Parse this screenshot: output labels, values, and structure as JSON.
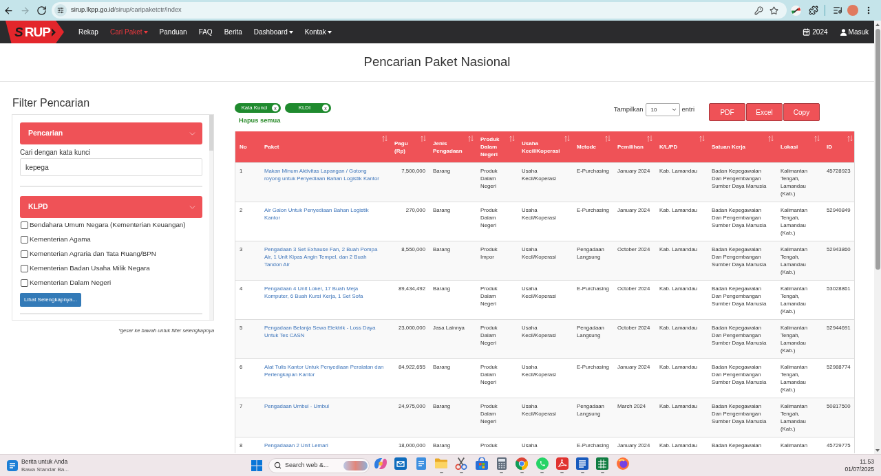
{
  "browser": {
    "nav_buttons": [
      {
        "kind": "back",
        "disabled": false
      },
      {
        "kind": "forward",
        "disabled": true
      },
      {
        "kind": "reload",
        "disabled": false
      }
    ],
    "url": {
      "host": "sirup.lkpp.go.id",
      "path": "/sirup/caripaketctr/index"
    }
  },
  "navbar": {
    "logo": {
      "dark_part": "S",
      "light_part": "RUP"
    },
    "items": [
      {
        "label": "Rekap",
        "selected": false,
        "dropdown": false
      },
      {
        "label": "Cari Paket",
        "selected": true,
        "dropdown": true
      },
      {
        "label": "Panduan",
        "selected": false,
        "dropdown": false
      },
      {
        "label": "FAQ",
        "selected": false,
        "dropdown": false
      },
      {
        "label": "Berita",
        "selected": false,
        "dropdown": false
      },
      {
        "label": "Dashboard",
        "selected": false,
        "dropdown": true
      },
      {
        "label": "Kontak",
        "selected": false,
        "dropdown": true
      }
    ],
    "right_items": [
      {
        "kind": "calendar",
        "label": "2024"
      },
      {
        "kind": "user",
        "label": "Masuk"
      }
    ]
  },
  "page_title": "Pencarian Paket Nasional",
  "filter": {
    "title": "Filter Pencarian",
    "sections": [
      {
        "kind": "search",
        "title": "Pencarian",
        "field_label": "Cari dengan kata kunci",
        "value": "kepega"
      },
      {
        "kind": "checklist",
        "title": "KLPD",
        "options": [
          {
            "label": "Bendahara Umum Negara (Kementerian Keuangan)",
            "checked": false
          },
          {
            "label": "Kementerian Agama",
            "checked": false
          },
          {
            "label": "Kementerian Agraria dan Tata Ruang/BPN",
            "checked": false
          },
          {
            "label": "Kementerian Badan Usaha Milik Negara",
            "checked": false
          },
          {
            "label": "Kementerian Dalam Negeri",
            "checked": false
          }
        ],
        "more_button": "Lihat Selengkapnya..."
      }
    ],
    "note": "*geser ke bawah untuk filter selengkapnya"
  },
  "active_filters": {
    "chips": [
      {
        "label": "Kata Kunci",
        "remove": "x"
      },
      {
        "label": "KLDI",
        "remove": "x"
      }
    ],
    "clear_all": "Hapus semua"
  },
  "page_length": {
    "label": "Tampilkan",
    "value": "10",
    "suffix": "entri"
  },
  "export_buttons": [
    "PDF",
    "Excel",
    "Copy"
  ],
  "table": {
    "columns": [
      {
        "label": "No",
        "kind": "text",
        "sortable": false
      },
      {
        "label": "Paket",
        "kind": "link",
        "sortable": true
      },
      {
        "label": "Pagu (Rp)",
        "kind": "number",
        "sortable": true
      },
      {
        "label": "Jenis Pengadaan",
        "kind": "text",
        "sortable": true
      },
      {
        "label": "Produk Dalam Negeri",
        "kind": "text",
        "sortable": true
      },
      {
        "label": "Usaha Kecil/Koperasi",
        "kind": "text",
        "sortable": true
      },
      {
        "label": "Metode",
        "kind": "text",
        "sortable": true
      },
      {
        "label": "Pemilihan",
        "kind": "text",
        "sortable": true
      },
      {
        "label": "K/L/PD",
        "kind": "text",
        "sortable": true
      },
      {
        "label": "Satuan Kerja",
        "kind": "text",
        "sortable": true
      },
      {
        "label": "Lokasi",
        "kind": "text",
        "sortable": true
      },
      {
        "label": "ID",
        "kind": "text",
        "sortable": true
      }
    ],
    "rows": [
      [
        "1",
        "Makan Minum Aktivitas Lapangan / Gotong royong untuk Penyediaan Bahan Logistik Kantor",
        "7,500,000",
        "Barang",
        "Produk Dalam Negeri",
        "Usaha Kecil/Koperasi",
        "E-Purchasing",
        "January 2024",
        "Kab. Lamandau",
        "Badan Kepegawaian Dan Pengembangan Sumber Daya Manusia",
        "Kalimantan Tengah, Lamandau (Kab.)",
        "45728923"
      ],
      [
        "2",
        "Air Galon Untuk Penyediaan Bahan Logistik Kantor",
        "270,000",
        "Barang",
        "Produk Dalam Negeri",
        "Usaha Kecil/Koperasi",
        "E-Purchasing",
        "January 2024",
        "Kab. Lamandau",
        "Badan Kepegawaian Dan Pengembangan Sumber Daya Manusia",
        "Kalimantan Tengah, Lamandau (Kab.)",
        "52940849"
      ],
      [
        "3",
        "Pengadaan 3 Set Exhause Fan, 2 Buah Pompa Air, 1 Unit Kipas Angin Tempel, dan 2 Buah Tandon Air",
        "8,550,000",
        "Barang",
        "Produk Impor",
        "Usaha Kecil/Koperasi",
        "Pengadaan Langsung",
        "October 2024",
        "Kab. Lamandau",
        "Badan Kepegawaian Dan Pengembangan Sumber Daya Manusia",
        "Kalimantan Tengah, Lamandau (Kab.)",
        "52943860"
      ],
      [
        "4",
        "Pengadaan 4 Unit Loker, 17 Buah Meja Komputer, 6 Buah Kursi Kerja, 1 Set Sofa",
        "89,434,492",
        "Barang",
        "Produk Dalam Negeri",
        "Usaha Kecil/Koperasi",
        "E-Purchasing",
        "October 2024",
        "Kab. Lamandau",
        "Badan Kepegawaian Dan Pengembangan Sumber Daya Manusia",
        "Kalimantan Tengah, Lamandau (Kab.)",
        "53028861"
      ],
      [
        "5",
        "Pengadaan Belanja Sewa Elektrik - Loss Daya Untuk Tes CASN",
        "23,000,000",
        "Jasa Lainnya",
        "Produk Dalam Negeri",
        "Usaha Kecil/Koperasi",
        "Pengadaan Langsung",
        "October 2024",
        "Kab. Lamandau",
        "Badan Kepegawaian Dan Pengembangan Sumber Daya Manusia",
        "Kalimantan Tengah, Lamandau (Kab.)",
        "52944691"
      ],
      [
        "6",
        "Alat Tulis Kantor Untuk Penyediaan Peralatan dan Perlengkapan Kantor",
        "84,922,655",
        "Barang",
        "Produk Dalam Negeri",
        "Usaha Kecil/Koperasi",
        "E-Purchasing",
        "January 2024",
        "Kab. Lamandau",
        "Badan Kepegawaian Dan Pengembangan Sumber Daya Manusia",
        "Kalimantan Tengah, Lamandau (Kab.)",
        "52988774"
      ],
      [
        "7",
        "Pengadaan Umbul - Umbul",
        "24,975,000",
        "Barang",
        "Produk Dalam Negeri",
        "Usaha Kecil/Koperasi",
        "Pengadaan Langsung",
        "March 2024",
        "Kab. Lamandau",
        "Badan Kepegawaian Dan Pengembangan Sumber Daya Manusia",
        "Kalimantan Tengah, Lamandau (Kab.)",
        "50817500"
      ],
      [
        "8",
        "Pengadaaan 2 Unit Lemari",
        "18,000,000",
        "Barang",
        "Produk",
        "Usaha",
        "E-Purchasing",
        "January 2024",
        "Kab. Lamandau",
        "Badan Kepegawaian",
        "Kalimantan",
        "45729775"
      ]
    ]
  },
  "taskbar": {
    "news": {
      "title": "Berita untuk Anda",
      "subtitle": "Bawa Standar Ba..."
    },
    "search": {
      "placeholder": "Search web &..."
    },
    "apps": [
      {
        "kind": "copilot",
        "running": false
      },
      {
        "kind": "outlook",
        "running": false
      },
      {
        "kind": "notepad",
        "running": false
      },
      {
        "kind": "explorer",
        "running": true
      },
      {
        "kind": "snipping",
        "running": true
      },
      {
        "kind": "store",
        "running": false
      },
      {
        "kind": "calculator",
        "running": true
      },
      {
        "kind": "chrome",
        "running": true
      },
      {
        "kind": "whatsapp",
        "running": true
      },
      {
        "kind": "acrobat",
        "running": true
      },
      {
        "kind": "word",
        "running": true
      },
      {
        "kind": "excel",
        "running": true
      },
      {
        "kind": "firefox",
        "running": false
      }
    ],
    "clock": {
      "time": "11.53",
      "date": "01/07/2025"
    }
  }
}
